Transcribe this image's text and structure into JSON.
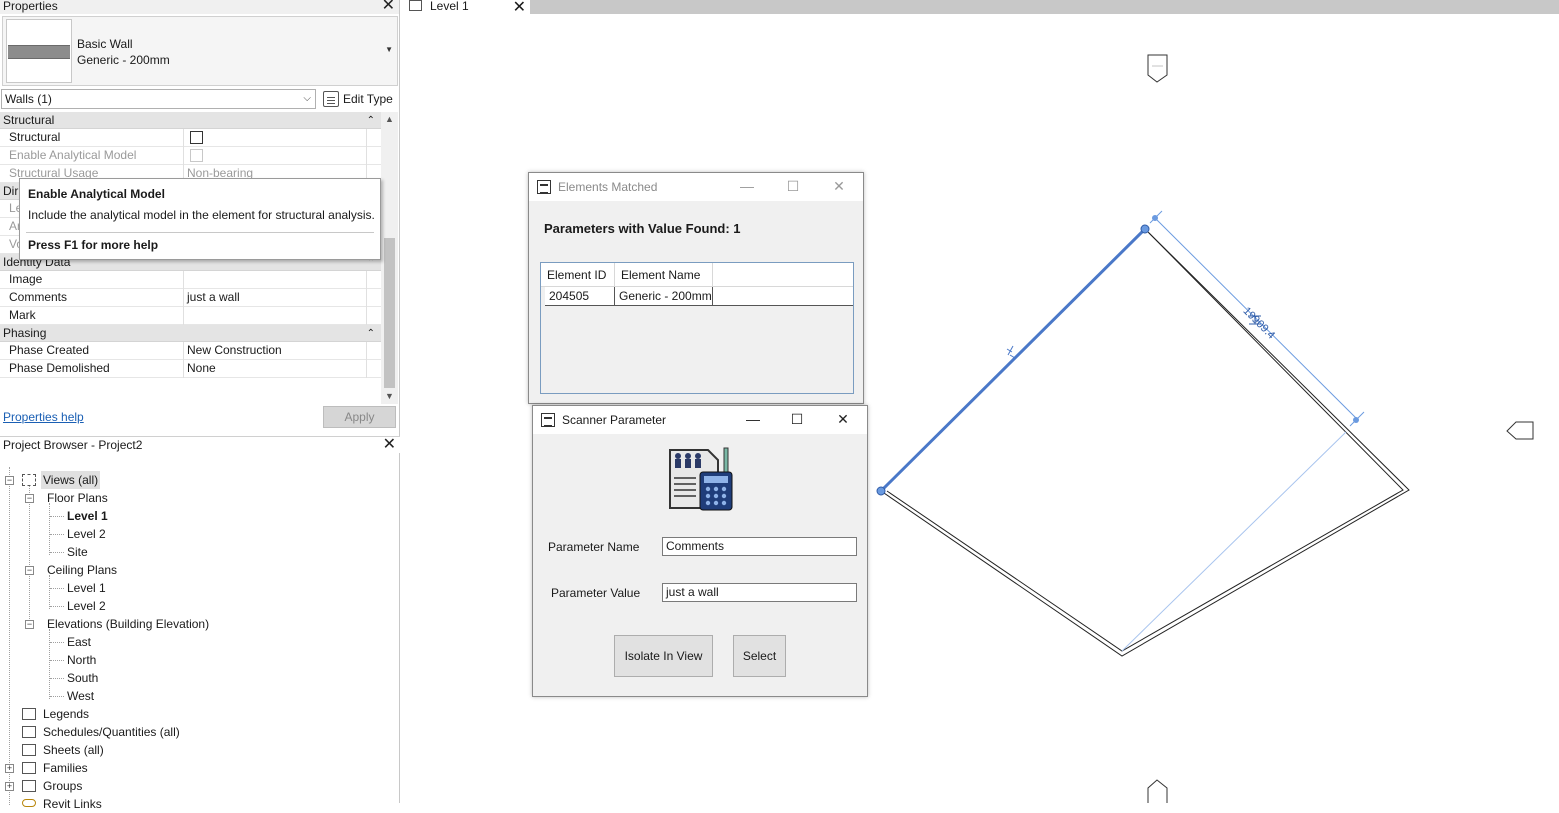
{
  "properties": {
    "title": "Properties",
    "type_family": "Basic Wall",
    "type_name": "Generic - 200mm",
    "filter": "Walls (1)",
    "edit_type": "Edit Type",
    "groups": {
      "structural": "Structural",
      "dimensions_abbrev": "Dir",
      "identity": "Identity Data",
      "phasing": "Phasing"
    },
    "rows": {
      "structural": "Structural",
      "enable_analytical": "Enable Analytical Model",
      "structural_usage": "Structural Usage",
      "structural_usage_value": "Non-bearing",
      "dim_row1": "Le",
      "dim_row2": "Ar",
      "dim_row3": "Vo",
      "image": "Image",
      "comments": "Comments",
      "comments_value": "just a wall",
      "mark": "Mark",
      "phase_created": "Phase Created",
      "phase_created_value": "New Construction",
      "phase_demolished": "Phase Demolished",
      "phase_demolished_value": "None"
    },
    "help_link": "Properties help",
    "apply": "Apply"
  },
  "tooltip": {
    "title": "Enable Analytical Model",
    "body": "Include the analytical model in the element for structural analysis.",
    "help": "Press F1 for more help"
  },
  "project_browser": {
    "title": "Project Browser - Project2",
    "views_all": "Views (all)",
    "floor_plans": "Floor Plans",
    "fp_level1": "Level 1",
    "fp_level2": "Level 2",
    "fp_site": "Site",
    "ceiling_plans": "Ceiling Plans",
    "cp_level1": "Level 1",
    "cp_level2": "Level 2",
    "elevations": "Elevations (Building Elevation)",
    "east": "East",
    "north": "North",
    "south": "South",
    "west": "West",
    "legends": "Legends",
    "schedules": "Schedules/Quantities (all)",
    "sheets": "Sheets (all)",
    "families": "Families",
    "groups": "Groups",
    "revit_links": "Revit Links"
  },
  "view_tab": {
    "label": "Level 1"
  },
  "canvas": {
    "dimension": "19909.4",
    "wall_color": "#4a78c8",
    "dim_color": "#6a9ae0"
  },
  "elements_matched": {
    "title": "Elements Matched",
    "heading": "Parameters with Value Found: 1",
    "columns": [
      "Element ID",
      "Element Name"
    ],
    "rows": [
      {
        "id": "204505",
        "name": "Generic - 200mm"
      }
    ]
  },
  "scanner": {
    "title": "Scanner Parameter",
    "param_name_label": "Parameter Name",
    "param_name_value": "Comments",
    "param_value_label": "Parameter Value",
    "param_value_value": "just a wall",
    "isolate_button": "Isolate In View",
    "select_button": "Select"
  }
}
